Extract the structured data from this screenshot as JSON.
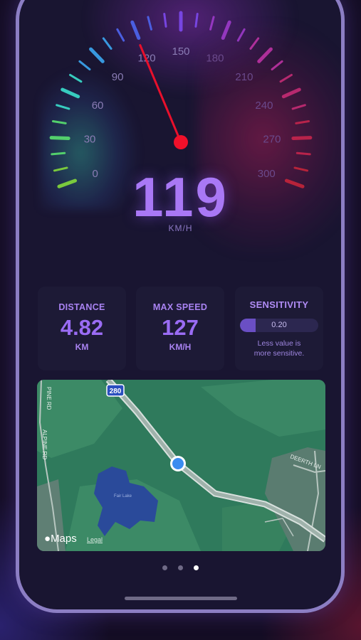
{
  "speedometer": {
    "speed_value": "119",
    "speed_unit": "KM/H",
    "needle_speed": 119,
    "max_scale": 300,
    "scale_labels": [
      "0",
      "30",
      "60",
      "90",
      "120",
      "150",
      "180",
      "210",
      "240",
      "270",
      "300"
    ]
  },
  "stats": {
    "distance": {
      "label": "DISTANCE",
      "value": "4.82",
      "unit": "KM"
    },
    "max_speed": {
      "label": "MAX SPEED",
      "value": "127",
      "unit": "KM/H"
    },
    "sensitivity": {
      "label": "SENSITIVITY",
      "value": "0.20",
      "level": 0.2,
      "hint_line1": "Less value is",
      "hint_line2": "more sensitive."
    }
  },
  "map": {
    "brand": "Maps",
    "legal": "Legal",
    "highway_shield": "280",
    "road_labels": [
      "PINE RD",
      "ALPINE RD",
      "DEERTH LN",
      "Fair Lake"
    ]
  },
  "pager": {
    "pages": 3,
    "active_index": 2
  },
  "colors": {
    "accent": "#9a6cf4",
    "needle": "#e8102c",
    "card_bg": "#1d1a36",
    "map_green": "#2f7a5c",
    "location_dot": "#3b8cf0"
  }
}
